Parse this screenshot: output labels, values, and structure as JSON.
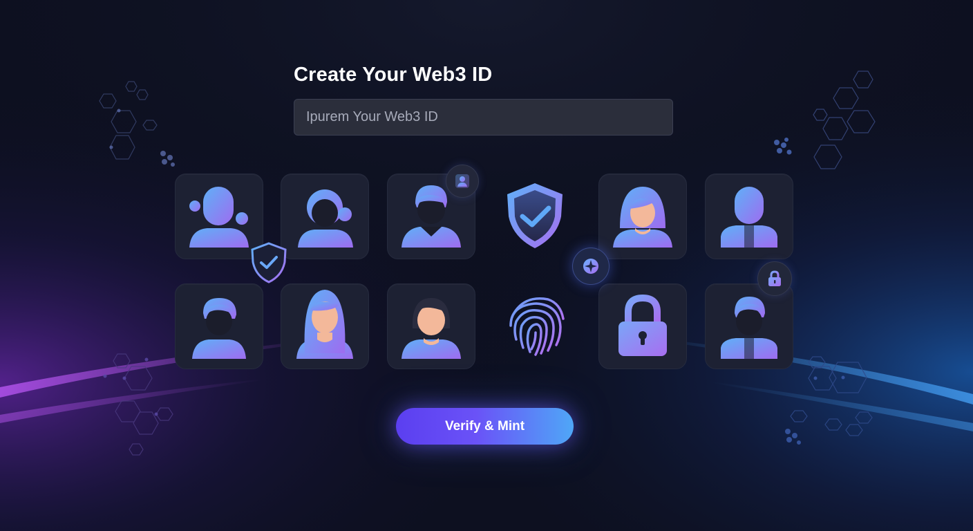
{
  "form": {
    "title": "Create Your Web3 ID",
    "input_placeholder": "Ipurem Your Web3 ID",
    "input_value": ""
  },
  "actions": {
    "verify_mint_label": "Verify & Mint"
  },
  "avatar_grid": {
    "row_1": [
      "person-icon",
      "woman-icon",
      "man-icon",
      "shield-check-icon",
      "woman-icon",
      "person-icon"
    ],
    "row_2": [
      "man-icon",
      "woman-long-hair-icon",
      "woman-icon",
      "fingerprint-icon",
      "padlock-icon",
      "man-icon"
    ],
    "badges": [
      "shield-check-icon",
      "user-icon",
      "compass-icon",
      "lock-icon"
    ]
  },
  "colors": {
    "background": "#0d1020",
    "tile": "#1d2133",
    "gradient_start": "#6b6bf5",
    "gradient_end": "#a86ef0",
    "accent_purple": "#a23ee6",
    "accent_blue": "#2f7cf0",
    "cta_start": "#5b3ff0",
    "cta_end": "#4fa7f7"
  }
}
